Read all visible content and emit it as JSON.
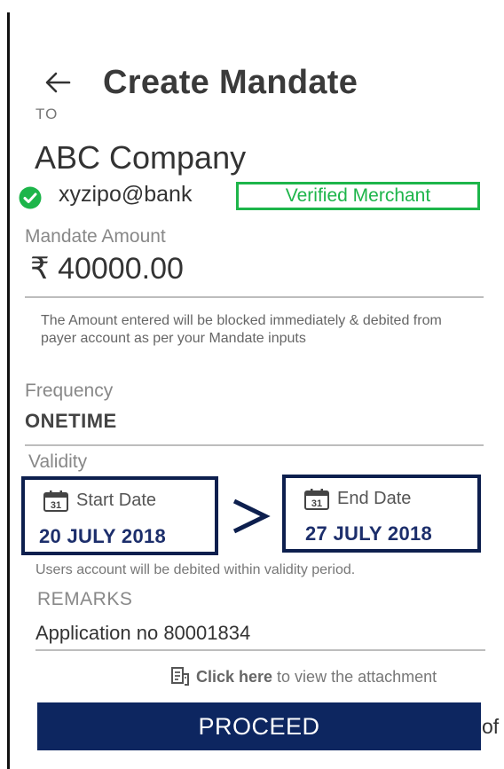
{
  "header": {
    "title": "Create Mandate",
    "back_icon": "arrow-left-icon"
  },
  "payee": {
    "to_label": "TO",
    "name": "ABC Company",
    "vpa": "xyzipo@bank",
    "verified_icon": "check-circle-icon",
    "verified_badge": "Verified Merchant"
  },
  "amount": {
    "label": "Mandate Amount",
    "value": "₹ 40000.00",
    "note": "The Amount entered will be blocked immediately & debited from payer account as per your Mandate inputs"
  },
  "frequency": {
    "label": "Frequency",
    "value": "ONETIME"
  },
  "validity": {
    "label": "Validity",
    "start": {
      "caption": "Start Date",
      "value": "20 JULY 2018",
      "icon": "calendar-icon",
      "icon_day": "31"
    },
    "end": {
      "caption": "End Date",
      "value": "27 JULY 2018",
      "icon": "calendar-icon",
      "icon_day": "31"
    },
    "separator_icon": "chevron-right-icon",
    "note": "Users account will be debited within validity period."
  },
  "remarks": {
    "label": "REMARKS",
    "value": "Application no 80001834"
  },
  "attachment": {
    "icon": "document-icon",
    "link_strong": "Click here",
    "link_rest": "to view the attachment"
  },
  "actions": {
    "proceed_label": "PROCEED"
  },
  "trailing_text": "of",
  "colors": {
    "primary": "#0d2660",
    "date_border": "#0d1f4e",
    "date_text": "#1c2e6b",
    "verified": "#1db54a"
  }
}
